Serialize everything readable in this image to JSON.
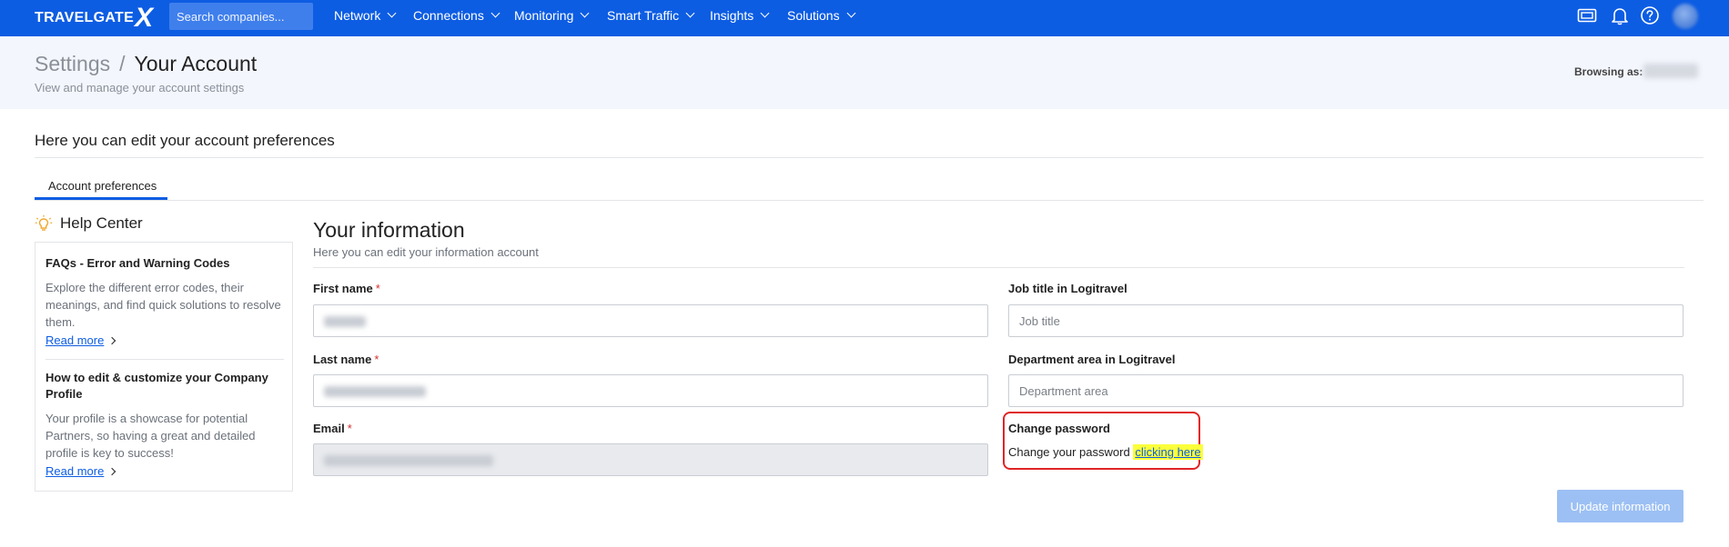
{
  "topbar": {
    "logo_text": "TRAVELGATE",
    "logo_x": "X",
    "search_placeholder": "Search companies...",
    "nav": [
      "Network",
      "Connections",
      "Monitoring",
      "Smart Traffic",
      "Insights",
      "Solutions"
    ],
    "icons": [
      "card-icon",
      "bell-icon",
      "help-icon",
      "avatar"
    ]
  },
  "header": {
    "crumb_settings": "Settings",
    "crumb_sep": "/",
    "crumb_current": "Your Account",
    "subtitle": "View and manage your account settings",
    "browsing_as": "Browsing as:"
  },
  "page": {
    "prefs_title": "Here you can edit your account preferences",
    "tab_label": "Account preferences"
  },
  "help": {
    "title": "Help Center",
    "items": [
      {
        "title": "FAQs - Error and Warning Codes",
        "desc": "Explore the different error codes, their meanings, and find quick solutions to resolve them.",
        "more": "Read more"
      },
      {
        "title": "How to edit & customize your Company Profile",
        "desc": "Your profile is a showcase for potential Partners, so having a great and detailed profile is key to success!",
        "more": "Read more"
      }
    ]
  },
  "form": {
    "title": "Your information",
    "subtitle": "Here you can edit your information account",
    "first_name_label": "First name",
    "last_name_label": "Last name",
    "email_label": "Email",
    "required_mark": "*",
    "job_title_label": "Job title in Logitravel",
    "job_title_placeholder": "Job title",
    "department_label": "Department area in Logitravel",
    "department_placeholder": "Department area",
    "change_password_label": "Change password",
    "change_password_text": "Change your password",
    "change_password_link": "clicking here",
    "update_button": "Update information"
  },
  "colors": {
    "brand": "#0d5de3",
    "highlight": "#fbff3a",
    "annotation": "#e02424",
    "required": "#d32f2f",
    "button_disabled": "#9cc0f4"
  }
}
